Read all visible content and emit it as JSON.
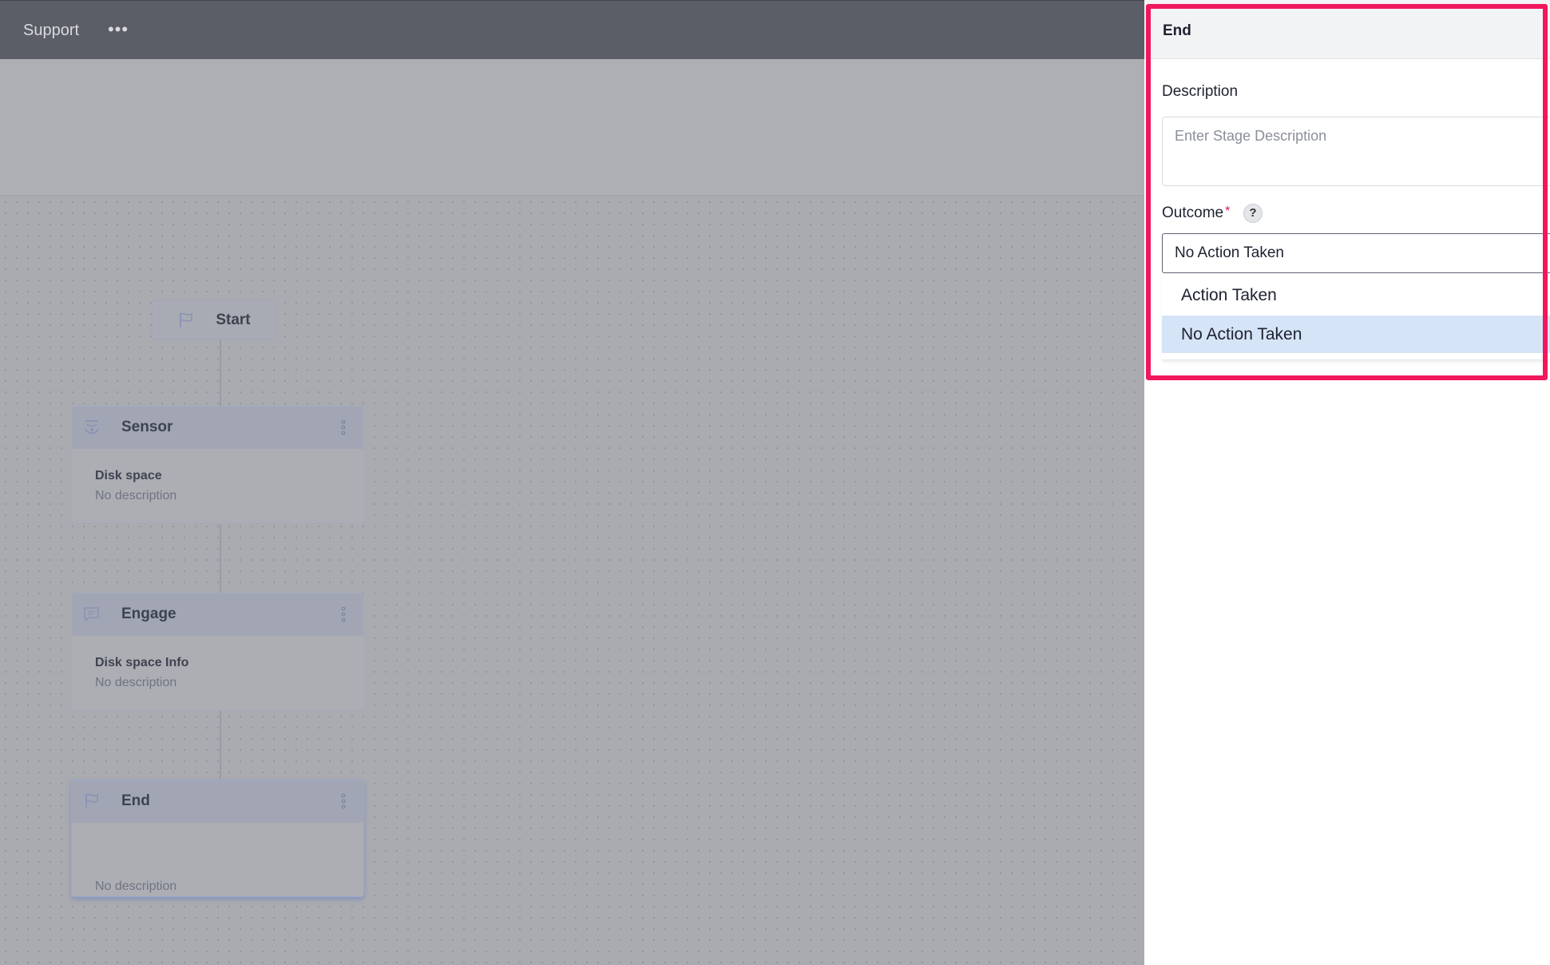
{
  "topbar": {
    "title": "Support",
    "more_label": "•••"
  },
  "flow": {
    "start": {
      "label": "Start",
      "icon": "flag-icon"
    },
    "stages": [
      {
        "title": "Sensor",
        "icon": "sensor-icon",
        "name": "Disk space",
        "description": "No description"
      },
      {
        "title": "Engage",
        "icon": "chat-icon",
        "name": "Disk space Info",
        "description": "No description"
      },
      {
        "title": "End",
        "icon": "flag-icon",
        "name": "",
        "description": "No description"
      }
    ]
  },
  "panel": {
    "title": "End",
    "description_label": "Description",
    "description_placeholder": "Enter Stage Description",
    "outcome_label": "Outcome",
    "required_mark": "*",
    "help_label": "?",
    "outcome_value": "No Action Taken",
    "options": [
      "Action Taken",
      "No Action Taken"
    ],
    "selected_option_index": 1
  },
  "colors": {
    "highlight": "#f0175d",
    "selected_option_bg": "#d6e4f8",
    "required": "#e0144f"
  }
}
